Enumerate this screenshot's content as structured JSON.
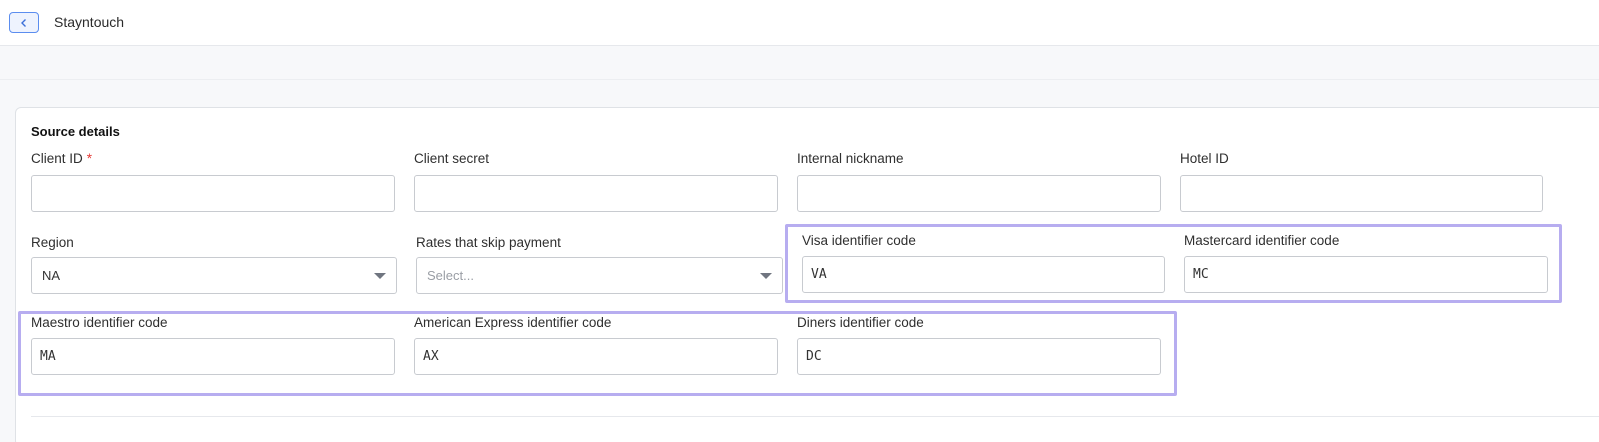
{
  "header": {
    "title": "Stayntouch",
    "back_icon": "chevron-left-icon"
  },
  "section": {
    "title": "Source details"
  },
  "fields": {
    "client_id": {
      "label": "Client ID",
      "required_mark": "*",
      "value": ""
    },
    "client_secret": {
      "label": "Client secret",
      "value": ""
    },
    "internal_nickname": {
      "label": "Internal nickname",
      "value": ""
    },
    "hotel_id": {
      "label": "Hotel ID",
      "value": ""
    },
    "region": {
      "label": "Region",
      "value": "NA"
    },
    "rates_skip_payment": {
      "label": "Rates that skip payment",
      "placeholder": "Select..."
    },
    "visa_code": {
      "label": "Visa identifier code",
      "value": "VA"
    },
    "mastercard_code": {
      "label": "Mastercard identifier code",
      "value": "MC"
    },
    "maestro_code": {
      "label": "Maestro identifier code",
      "value": "MA"
    },
    "amex_code": {
      "label": "American Express identifier code",
      "value": "AX"
    },
    "diners_code": {
      "label": "Diners identifier code",
      "value": "DC"
    }
  },
  "colors": {
    "accent": "#5b8def",
    "highlight": "#b7adf0",
    "required": "#e53935"
  }
}
